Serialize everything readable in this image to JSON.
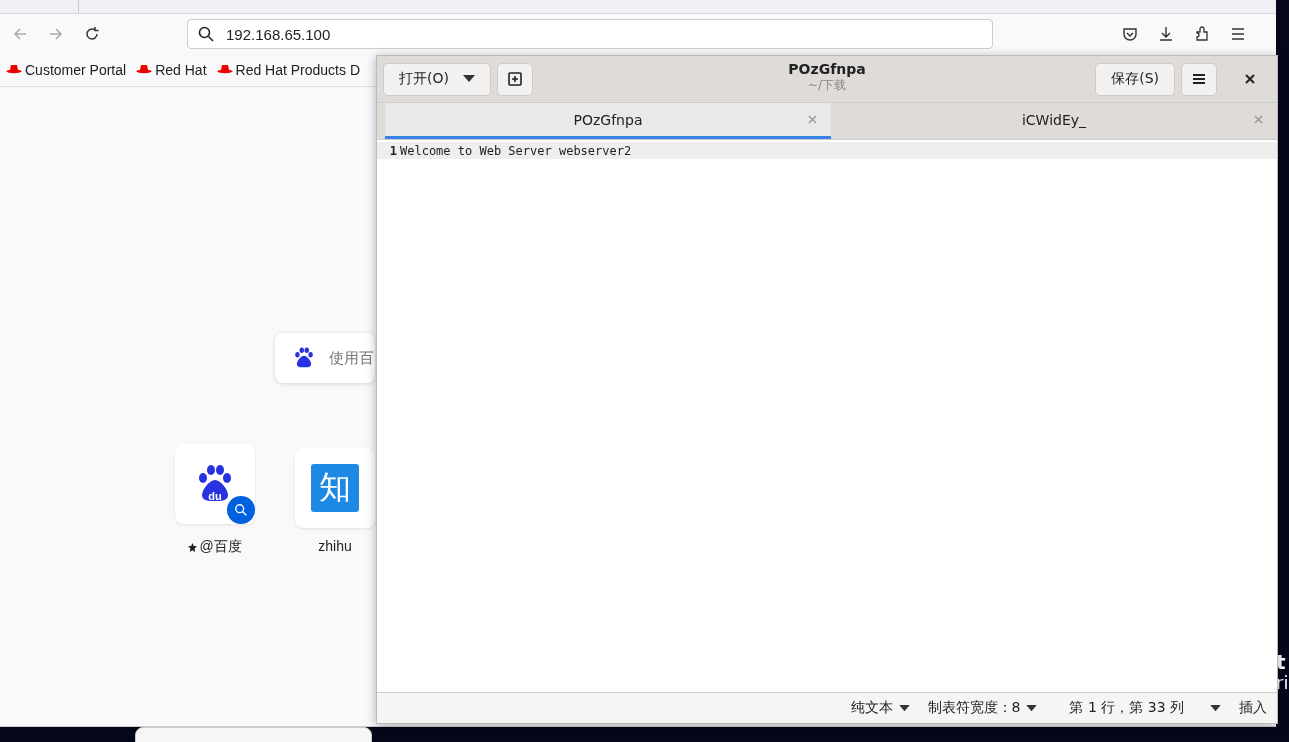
{
  "browser": {
    "url": "192.168.65.100",
    "bookmarks": [
      {
        "label": "Customer Portal"
      },
      {
        "label": "Red Hat"
      },
      {
        "label": "Red Hat Products D"
      }
    ],
    "search": {
      "placeholder": "使用百"
    },
    "shortcuts": [
      {
        "kind": "paw",
        "logo_text": "du",
        "label": "@百度",
        "pinned": true,
        "search_badge": true
      },
      {
        "kind": "tile",
        "logo_text": "知",
        "label": "zhihu",
        "pinned": false,
        "search_badge": false
      }
    ]
  },
  "editor": {
    "open_button": "打开(O)",
    "title": "POzGfnpa",
    "subtitle": "~/下载",
    "save_button": "保存(S)",
    "tabs": [
      {
        "label": "POzGfnpa",
        "selected": true
      },
      {
        "label": "iCWidEy_",
        "selected": false
      }
    ],
    "lines": [
      {
        "number": "1",
        "text": "Welcome to Web Server webserver2",
        "current": true
      }
    ],
    "status": {
      "language": "纯文本",
      "tab_width": "制表符宽度：8",
      "position": "第 1 行，第 33 列",
      "mode": "插入"
    }
  },
  "desktop": {
    "texts": [
      "t",
      "ri"
    ]
  }
}
